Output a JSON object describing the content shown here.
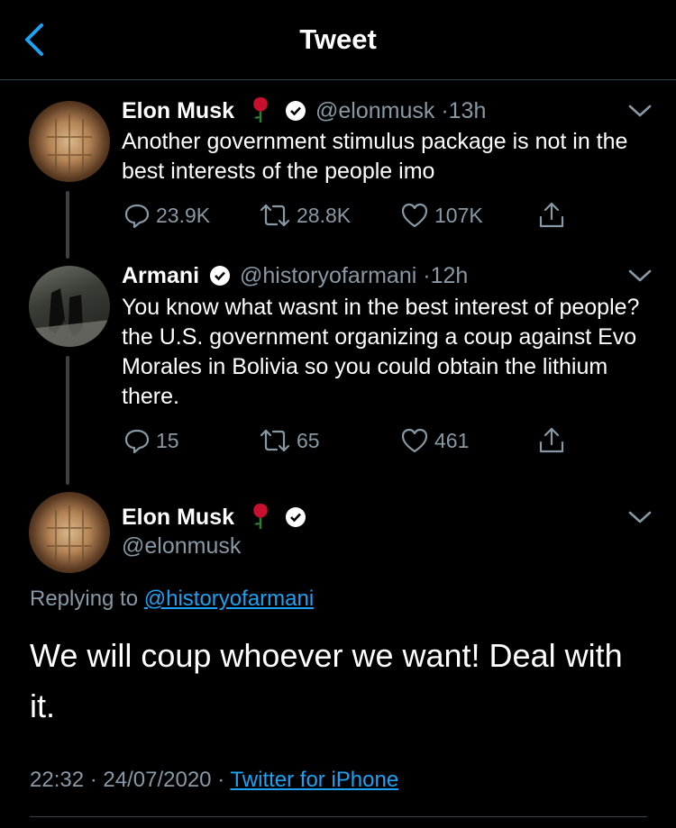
{
  "header": {
    "title": "Tweet"
  },
  "tweets": [
    {
      "name": "Elon Musk",
      "handle": "@elonmusk",
      "sep": "·",
      "time": "13h",
      "text": "Another government stimulus package is not in the best interests of the people imo",
      "replies": "23.9K",
      "retweets": "28.8K",
      "likes": "107K"
    },
    {
      "name": "Armani",
      "handle": "@historyofarmani",
      "sep": "·",
      "time": "12h",
      "text": "You know what wasnt in the best interest of people? the U.S. government organizing a coup against Evo Morales in Bolivia so you could obtain the lithium there.",
      "replies": "15",
      "retweets": "65",
      "likes": "461"
    }
  ],
  "main": {
    "name": "Elon Musk",
    "handle": "@elonmusk",
    "replying_prefix": "Replying to",
    "replying_handle": "@historyofarmani",
    "text": "We will coup whoever we want! Deal with it.",
    "time": "22:32",
    "sep1": "·",
    "date": "24/07/2020",
    "sep2": "·",
    "source": "Twitter for iPhone"
  },
  "colors": {
    "link": "#1da1f2",
    "muted": "#8899a6",
    "verified": "#ffffff",
    "rose": "#c8102e"
  },
  "icons": [
    "chevron-left-icon",
    "verified-icon",
    "rose-icon",
    "reply-icon",
    "retweet-icon",
    "like-icon",
    "share-icon",
    "caret-down-icon"
  ]
}
